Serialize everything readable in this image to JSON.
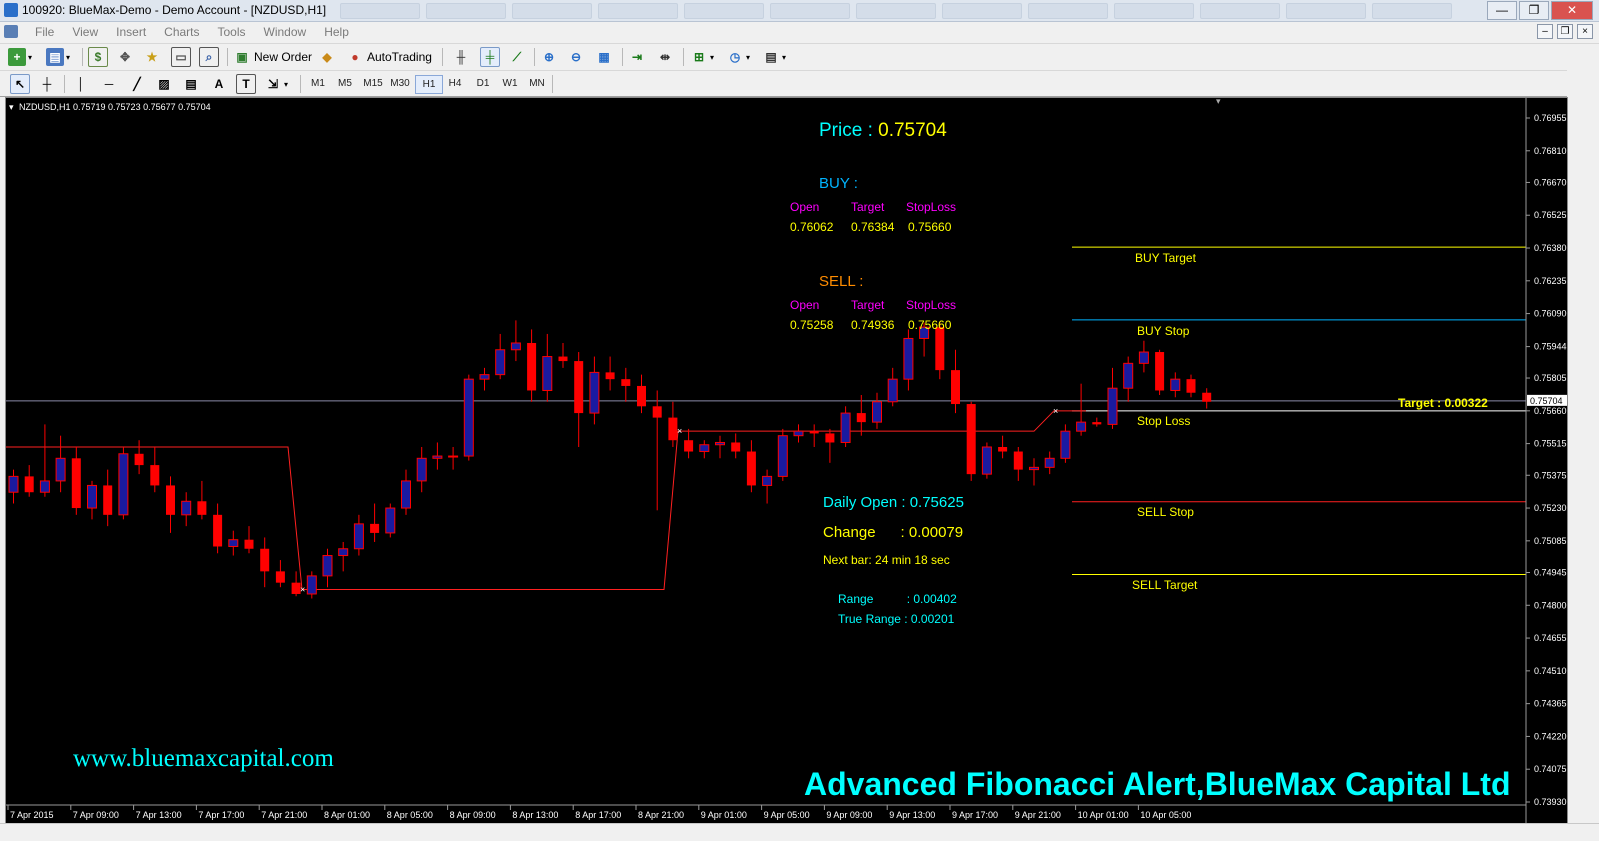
{
  "window": {
    "title": "100920: BlueMax-Demo - Demo Account - [NZDUSD,H1]",
    "buttons": [
      "—",
      "❐",
      "✕"
    ]
  },
  "menu": {
    "items": [
      "File",
      "View",
      "Insert",
      "Charts",
      "Tools",
      "Window",
      "Help"
    ],
    "mdi_buttons": [
      "–",
      "❐",
      "×"
    ]
  },
  "toolbar": {
    "new_order_label": "New Order",
    "autotrading_label": "AutoTrading",
    "timeframes": [
      "M1",
      "M5",
      "M15",
      "M30",
      "H1",
      "H4",
      "D1",
      "W1",
      "MN"
    ],
    "active_timeframe": "H1",
    "search_placeholder": ""
  },
  "chart": {
    "header": "NZDUSD,H1  0.75719 0.75723 0.75677 0.75704",
    "price_label": "Price : ",
    "price_value": "0.75704",
    "buy": {
      "title": "BUY :",
      "headers": [
        "Open",
        "Target",
        "StopLoss"
      ],
      "values": [
        "0.76062",
        "0.76384",
        "0.75660"
      ]
    },
    "sell": {
      "title": "SELL :",
      "headers": [
        "Open",
        "Target",
        "StopLoss"
      ],
      "values": [
        "0.75258",
        "0.74936",
        "0.75660"
      ]
    },
    "daily_open": "Daily Open : 0.75625",
    "change": "Change      : 0.00079",
    "next_bar": "Next bar: 24 min 18 sec",
    "range": "Range          : 0.00402",
    "true_range": "True Range : 0.00201",
    "level_labels": {
      "buy_target": "BUY Target",
      "buy_stop": "BUY Stop",
      "stop_loss": "Stop Loss",
      "sell_stop": "SELL Stop",
      "sell_target": "SELL Target"
    },
    "target_label": "Target : 0.00322",
    "current_price_tag": "0.75704",
    "watermark_url": "www.bluemaxcapital.com",
    "watermark_title": "Advanced Fibonacci Alert,BlueMax Capital Ltd",
    "colors": {
      "bull": "#1a1aa0",
      "bear": "#ff0000",
      "grid_text": "#ffffff",
      "cyan": "#00ffff",
      "yellow": "#ffff00",
      "magenta": "#ff00ff",
      "orange": "#ff8c00",
      "sky": "#00b4ff"
    }
  },
  "chart_data": {
    "type": "candlestick",
    "symbol": "NZDUSD",
    "timeframe": "H1",
    "ylim": [
      0.7393,
      0.7702
    ],
    "y_ticks": [
      "0.76955",
      "0.76810",
      "0.76670",
      "0.76525",
      "0.76380",
      "0.76235",
      "0.76090",
      "0.75944",
      "0.75805",
      "0.75660",
      "0.75515",
      "0.75375",
      "0.75230",
      "0.75085",
      "0.74945",
      "0.74800",
      "0.74655",
      "0.74510",
      "0.74365",
      "0.74220",
      "0.74075",
      "0.73930"
    ],
    "x_ticks": [
      "7 Apr 2015",
      "7 Apr 09:00",
      "7 Apr 13:00",
      "7 Apr 17:00",
      "7 Apr 21:00",
      "8 Apr 01:00",
      "8 Apr 05:00",
      "8 Apr 09:00",
      "8 Apr 13:00",
      "8 Apr 17:00",
      "8 Apr 21:00",
      "9 Apr 01:00",
      "9 Apr 05:00",
      "9 Apr 09:00",
      "9 Apr 13:00",
      "9 Apr 17:00",
      "9 Apr 21:00",
      "10 Apr 01:00",
      "10 Apr 05:00"
    ],
    "levels": {
      "buy_target": 0.76384,
      "buy_stop": 0.76062,
      "stop_loss": 0.7566,
      "sell_stop": 0.75258,
      "sell_target": 0.74936,
      "current": 0.75704
    },
    "candles": [
      {
        "o": 0.753,
        "h": 0.754,
        "l": 0.7525,
        "c": 0.7537
      },
      {
        "o": 0.7537,
        "h": 0.7542,
        "l": 0.7528,
        "c": 0.753
      },
      {
        "o": 0.753,
        "h": 0.756,
        "l": 0.7528,
        "c": 0.7535
      },
      {
        "o": 0.7535,
        "h": 0.7555,
        "l": 0.753,
        "c": 0.7545
      },
      {
        "o": 0.7545,
        "h": 0.755,
        "l": 0.752,
        "c": 0.7523
      },
      {
        "o": 0.7523,
        "h": 0.7535,
        "l": 0.7518,
        "c": 0.7533
      },
      {
        "o": 0.7533,
        "h": 0.754,
        "l": 0.7515,
        "c": 0.752
      },
      {
        "o": 0.752,
        "h": 0.755,
        "l": 0.7518,
        "c": 0.7547
      },
      {
        "o": 0.7547,
        "h": 0.7553,
        "l": 0.7538,
        "c": 0.7542
      },
      {
        "o": 0.7542,
        "h": 0.755,
        "l": 0.753,
        "c": 0.7533
      },
      {
        "o": 0.7533,
        "h": 0.7537,
        "l": 0.7512,
        "c": 0.752
      },
      {
        "o": 0.752,
        "h": 0.753,
        "l": 0.7515,
        "c": 0.7526
      },
      {
        "o": 0.7526,
        "h": 0.7535,
        "l": 0.7518,
        "c": 0.752
      },
      {
        "o": 0.752,
        "h": 0.7525,
        "l": 0.7503,
        "c": 0.7506
      },
      {
        "o": 0.7506,
        "h": 0.7513,
        "l": 0.7502,
        "c": 0.7509
      },
      {
        "o": 0.7509,
        "h": 0.7515,
        "l": 0.7503,
        "c": 0.7505
      },
      {
        "o": 0.7505,
        "h": 0.751,
        "l": 0.7488,
        "c": 0.7495
      },
      {
        "o": 0.7495,
        "h": 0.75,
        "l": 0.7488,
        "c": 0.749
      },
      {
        "o": 0.749,
        "h": 0.7495,
        "l": 0.7484,
        "c": 0.7485
      },
      {
        "o": 0.7485,
        "h": 0.7495,
        "l": 0.7483,
        "c": 0.7493
      },
      {
        "o": 0.7493,
        "h": 0.7505,
        "l": 0.7488,
        "c": 0.7502
      },
      {
        "o": 0.7502,
        "h": 0.7508,
        "l": 0.7495,
        "c": 0.7505
      },
      {
        "o": 0.7505,
        "h": 0.752,
        "l": 0.7502,
        "c": 0.7516
      },
      {
        "o": 0.7516,
        "h": 0.7525,
        "l": 0.7508,
        "c": 0.7512
      },
      {
        "o": 0.7512,
        "h": 0.7525,
        "l": 0.751,
        "c": 0.7523
      },
      {
        "o": 0.7523,
        "h": 0.754,
        "l": 0.752,
        "c": 0.7535
      },
      {
        "o": 0.7535,
        "h": 0.755,
        "l": 0.753,
        "c": 0.7545
      },
      {
        "o": 0.7545,
        "h": 0.7552,
        "l": 0.754,
        "c": 0.7546
      },
      {
        "o": 0.7546,
        "h": 0.755,
        "l": 0.754,
        "c": 0.7546
      },
      {
        "o": 0.7546,
        "h": 0.7582,
        "l": 0.7544,
        "c": 0.758
      },
      {
        "o": 0.758,
        "h": 0.7585,
        "l": 0.7575,
        "c": 0.7582
      },
      {
        "o": 0.7582,
        "h": 0.76,
        "l": 0.758,
        "c": 0.7593
      },
      {
        "o": 0.7593,
        "h": 0.7606,
        "l": 0.7588,
        "c": 0.7596
      },
      {
        "o": 0.7596,
        "h": 0.7602,
        "l": 0.757,
        "c": 0.7575
      },
      {
        "o": 0.7575,
        "h": 0.76,
        "l": 0.757,
        "c": 0.759
      },
      {
        "o": 0.759,
        "h": 0.7596,
        "l": 0.7585,
        "c": 0.7588
      },
      {
        "o": 0.7588,
        "h": 0.7592,
        "l": 0.755,
        "c": 0.7565
      },
      {
        "o": 0.7565,
        "h": 0.759,
        "l": 0.756,
        "c": 0.7583
      },
      {
        "o": 0.7583,
        "h": 0.759,
        "l": 0.7575,
        "c": 0.758
      },
      {
        "o": 0.758,
        "h": 0.7585,
        "l": 0.757,
        "c": 0.7577
      },
      {
        "o": 0.7577,
        "h": 0.7582,
        "l": 0.7565,
        "c": 0.7568
      },
      {
        "o": 0.7568,
        "h": 0.7575,
        "l": 0.7522,
        "c": 0.7563
      },
      {
        "o": 0.7563,
        "h": 0.757,
        "l": 0.755,
        "c": 0.7553
      },
      {
        "o": 0.7553,
        "h": 0.7558,
        "l": 0.7545,
        "c": 0.7548
      },
      {
        "o": 0.7548,
        "h": 0.7553,
        "l": 0.7545,
        "c": 0.7551
      },
      {
        "o": 0.7551,
        "h": 0.7555,
        "l": 0.7545,
        "c": 0.7552
      },
      {
        "o": 0.7552,
        "h": 0.7556,
        "l": 0.7545,
        "c": 0.7548
      },
      {
        "o": 0.7548,
        "h": 0.7553,
        "l": 0.753,
        "c": 0.7533
      },
      {
        "o": 0.7533,
        "h": 0.754,
        "l": 0.7525,
        "c": 0.7537
      },
      {
        "o": 0.7537,
        "h": 0.7558,
        "l": 0.7535,
        "c": 0.7555
      },
      {
        "o": 0.7555,
        "h": 0.756,
        "l": 0.7552,
        "c": 0.7557
      },
      {
        "o": 0.7557,
        "h": 0.756,
        "l": 0.755,
        "c": 0.7556
      },
      {
        "o": 0.7556,
        "h": 0.7558,
        "l": 0.7543,
        "c": 0.7552
      },
      {
        "o": 0.7552,
        "h": 0.7568,
        "l": 0.755,
        "c": 0.7565
      },
      {
        "o": 0.7565,
        "h": 0.7573,
        "l": 0.7555,
        "c": 0.7561
      },
      {
        "o": 0.7561,
        "h": 0.7574,
        "l": 0.7558,
        "c": 0.757
      },
      {
        "o": 0.757,
        "h": 0.7585,
        "l": 0.7568,
        "c": 0.758
      },
      {
        "o": 0.758,
        "h": 0.7602,
        "l": 0.7575,
        "c": 0.7598
      },
      {
        "o": 0.7598,
        "h": 0.7605,
        "l": 0.759,
        "c": 0.7603
      },
      {
        "o": 0.7603,
        "h": 0.7605,
        "l": 0.758,
        "c": 0.7584
      },
      {
        "o": 0.7584,
        "h": 0.7593,
        "l": 0.7565,
        "c": 0.7569
      },
      {
        "o": 0.7569,
        "h": 0.757,
        "l": 0.7535,
        "c": 0.7538
      },
      {
        "o": 0.7538,
        "h": 0.7552,
        "l": 0.7536,
        "c": 0.755
      },
      {
        "o": 0.755,
        "h": 0.7555,
        "l": 0.7545,
        "c": 0.7548
      },
      {
        "o": 0.7548,
        "h": 0.755,
        "l": 0.7535,
        "c": 0.754
      },
      {
        "o": 0.754,
        "h": 0.7545,
        "l": 0.7533,
        "c": 0.7541
      },
      {
        "o": 0.7541,
        "h": 0.7548,
        "l": 0.7538,
        "c": 0.7545
      },
      {
        "o": 0.7545,
        "h": 0.756,
        "l": 0.7543,
        "c": 0.7557
      },
      {
        "o": 0.7557,
        "h": 0.7578,
        "l": 0.7555,
        "c": 0.7561
      },
      {
        "o": 0.7561,
        "h": 0.7563,
        "l": 0.7559,
        "c": 0.756
      },
      {
        "o": 0.756,
        "h": 0.7585,
        "l": 0.7558,
        "c": 0.7576
      },
      {
        "o": 0.7576,
        "h": 0.759,
        "l": 0.757,
        "c": 0.7587
      },
      {
        "o": 0.7587,
        "h": 0.7597,
        "l": 0.7583,
        "c": 0.7592
      },
      {
        "o": 0.7592,
        "h": 0.7593,
        "l": 0.7573,
        "c": 0.7575
      },
      {
        "o": 0.7575,
        "h": 0.7583,
        "l": 0.7572,
        "c": 0.758
      },
      {
        "o": 0.758,
        "h": 0.7582,
        "l": 0.7572,
        "c": 0.7574
      },
      {
        "o": 0.7574,
        "h": 0.7576,
        "l": 0.7567,
        "c": 0.757
      }
    ]
  }
}
